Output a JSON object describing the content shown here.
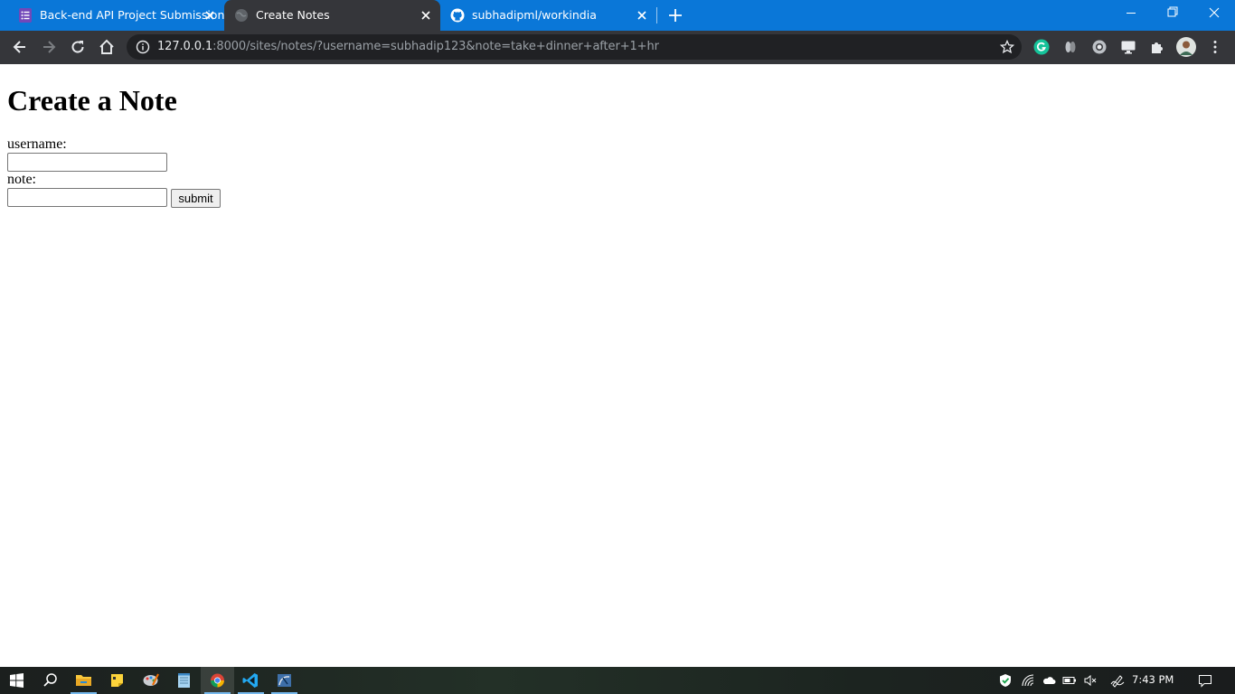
{
  "browser": {
    "tabs": [
      {
        "title": "Back-end API Project Submission",
        "favicon": "forms-icon",
        "active": false
      },
      {
        "title": "Create Notes",
        "favicon": "globe-icon",
        "active": true
      },
      {
        "title": "subhadipml/workindia",
        "favicon": "github-icon",
        "active": false
      }
    ],
    "url_host": "127.0.0.1",
    "url_rest": ":8000/sites/notes/?username=subhadip123&note=take+dinner+after+1+hr",
    "accent_color": "#0a77d8"
  },
  "page": {
    "heading": "Create a Note",
    "username_label": "username:",
    "username_value": "",
    "note_label": "note:",
    "note_value": "",
    "submit_label": "submit"
  },
  "taskbar": {
    "clock": "7:43 PM"
  }
}
